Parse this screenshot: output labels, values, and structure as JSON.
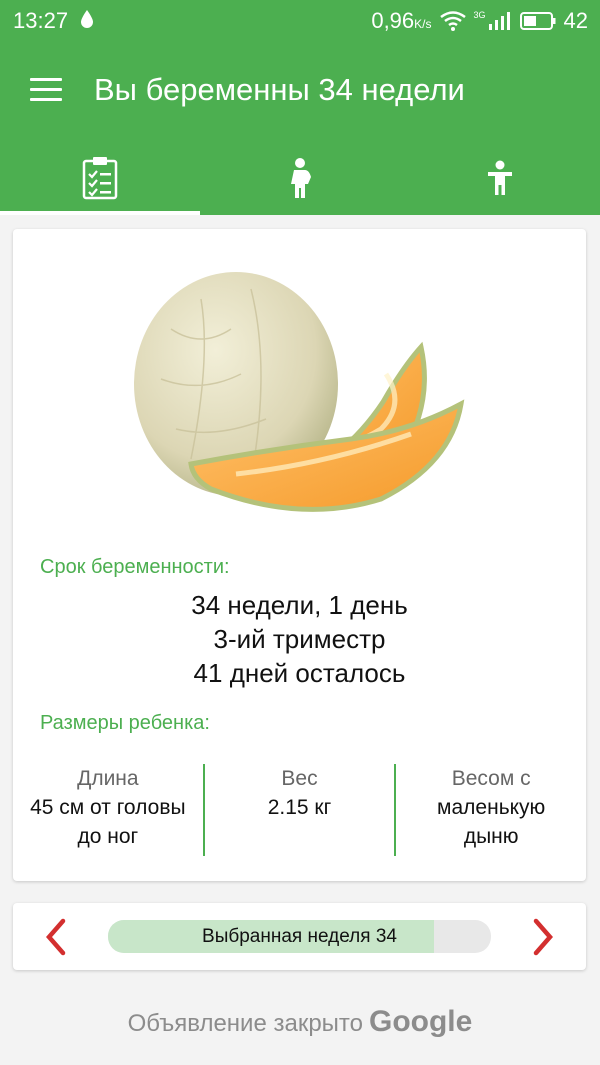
{
  "status_bar": {
    "time": "13:27",
    "speed": "0,96",
    "speed_unit": "K/s",
    "network": "3G",
    "battery": "42"
  },
  "toolbar": {
    "title": "Вы беременны 34 недели",
    "menu_icon": "hamburger-menu-icon"
  },
  "tabs": [
    {
      "icon": "clipboard-checklist-icon",
      "active": true
    },
    {
      "icon": "pregnant-woman-icon",
      "active": false
    },
    {
      "icon": "child-icon",
      "active": false
    }
  ],
  "card": {
    "image": "cantaloupe-melon-image",
    "term_label": "Срок беременности:",
    "term_lines": [
      "34 недели, 1 день",
      "3-ий триместр",
      "41 дней осталось"
    ],
    "baby_size_label": "Размеры ребенка:",
    "stats": [
      {
        "title": "Длина",
        "lines": [
          "45 см от головы",
          "до ног"
        ]
      },
      {
        "title": "Вес",
        "lines": [
          "2.15 кг"
        ]
      },
      {
        "title": "Весом с",
        "lines": [
          "маленькую",
          "дыню"
        ]
      }
    ]
  },
  "week_nav": {
    "prev_icon": "chevron-left-icon",
    "next_icon": "chevron-right-icon",
    "label": "Выбранная неделя 34",
    "progress": 0.85
  },
  "ad": {
    "text": "Объявление закрыто",
    "brand": "Google"
  },
  "colors": {
    "primary": "#4caf50",
    "arrow": "#d32f2f",
    "progress_fill": "#c8e6c9"
  }
}
